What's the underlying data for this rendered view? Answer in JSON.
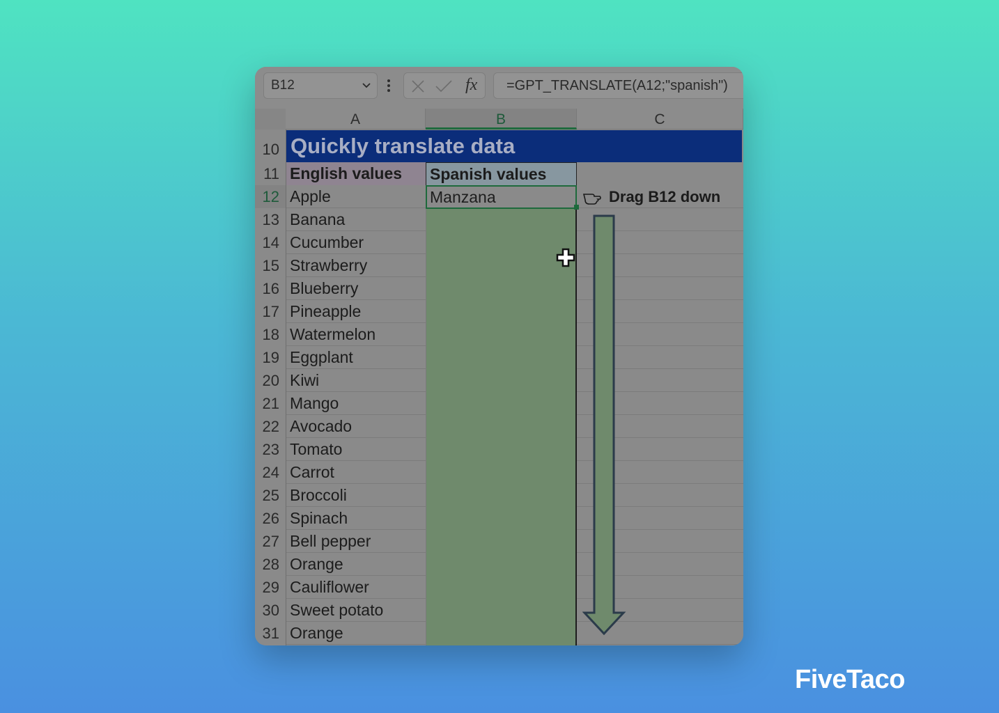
{
  "window": {
    "name_box": "B12",
    "formula_bar": "=GPT_TRANSLATE(A12;\"spanish\")",
    "fx_label": "fx",
    "columns": [
      "A",
      "B",
      "C"
    ],
    "selected_column": "B",
    "selected_row": "12",
    "title_row": {
      "row": "10",
      "text": "Quickly translate data"
    },
    "header_row": {
      "row": "11",
      "english": "English values",
      "spanish": "Spanish values"
    },
    "rows": [
      {
        "row": "12",
        "english": "Apple",
        "spanish": "Manzana"
      },
      {
        "row": "13",
        "english": "Banana",
        "spanish": ""
      },
      {
        "row": "14",
        "english": "Cucumber",
        "spanish": ""
      },
      {
        "row": "15",
        "english": "Strawberry",
        "spanish": ""
      },
      {
        "row": "16",
        "english": "Blueberry",
        "spanish": ""
      },
      {
        "row": "17",
        "english": "Pineapple",
        "spanish": ""
      },
      {
        "row": "18",
        "english": "Watermelon",
        "spanish": ""
      },
      {
        "row": "19",
        "english": "Eggplant",
        "spanish": ""
      },
      {
        "row": "20",
        "english": "Kiwi",
        "spanish": ""
      },
      {
        "row": "21",
        "english": "Mango",
        "spanish": ""
      },
      {
        "row": "22",
        "english": "Avocado",
        "spanish": ""
      },
      {
        "row": "23",
        "english": "Tomato",
        "spanish": ""
      },
      {
        "row": "24",
        "english": "Carrot",
        "spanish": ""
      },
      {
        "row": "25",
        "english": "Broccoli",
        "spanish": ""
      },
      {
        "row": "26",
        "english": "Spinach",
        "spanish": ""
      },
      {
        "row": "27",
        "english": "Bell pepper",
        "spanish": ""
      },
      {
        "row": "28",
        "english": "Orange",
        "spanish": ""
      },
      {
        "row": "29",
        "english": "Cauliflower",
        "spanish": ""
      },
      {
        "row": "30",
        "english": "Sweet potato",
        "spanish": ""
      },
      {
        "row": "31",
        "english": "Orange",
        "spanish": ""
      }
    ],
    "instruction": "Drag B12 down"
  },
  "brand": "FiveTaco"
}
